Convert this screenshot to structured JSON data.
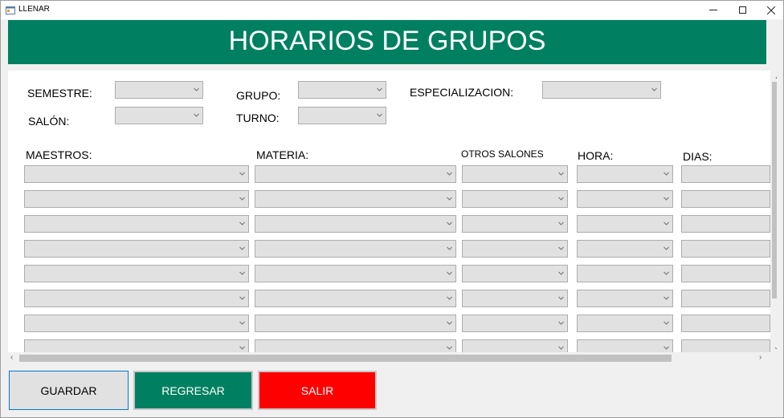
{
  "window": {
    "title": "LLENAR"
  },
  "header": {
    "title": "HORARIOS DE GRUPOS"
  },
  "colors": {
    "brand_green": "#008060",
    "exit_red": "#ff0000"
  },
  "form": {
    "semestre_label": "SEMESTRE:",
    "salon_label": "SALÓN:",
    "grupo_label": "GRUPO:",
    "turno_label": "TURNO:",
    "especializacion_label": "ESPECIALIZACION:"
  },
  "columns": {
    "maestros": "MAESTROS:",
    "materia": "MATERIA:",
    "otros_salones": "OTROS SALONES",
    "hora": "HORA:",
    "dias": "DIAS:"
  },
  "buttons": {
    "guardar": "GUARDAR",
    "regresar": "REGRESAR",
    "salir": "SALIR"
  }
}
